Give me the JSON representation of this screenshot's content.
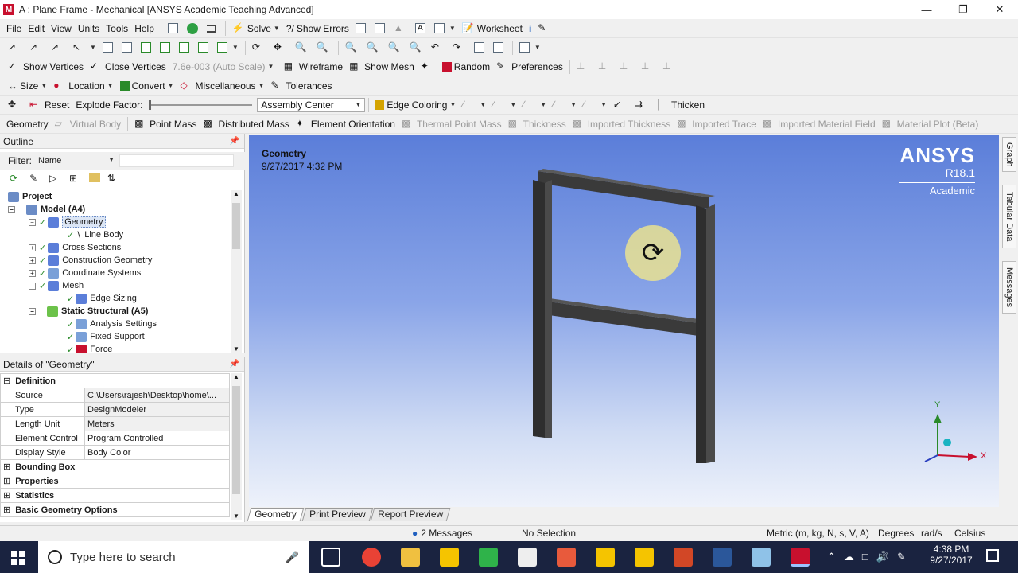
{
  "window": {
    "app_icon": "M",
    "title": "A : Plane Frame - Mechanical [ANSYS Academic Teaching Advanced]",
    "controls": [
      "minimize-icon",
      "restore-icon",
      "close-icon"
    ]
  },
  "menubar": {
    "items": [
      "File",
      "Edit",
      "View",
      "Units",
      "Tools",
      "Help"
    ],
    "solve": "Solve",
    "show_errors": "Show Errors",
    "worksheet": "Worksheet"
  },
  "toolbar3": {
    "show_vertices": "Show Vertices",
    "close_vertices": "Close Vertices",
    "scale": "7.6e-003 (Auto Scale)",
    "wireframe": "Wireframe",
    "show_mesh": "Show Mesh",
    "random": "Random",
    "preferences": "Preferences"
  },
  "toolbar4": {
    "size": "Size",
    "location": "Location",
    "convert": "Convert",
    "miscellaneous": "Miscellaneous",
    "tolerances": "Tolerances"
  },
  "toolbar5": {
    "reset": "Reset",
    "explode_factor": "Explode Factor:",
    "assembly_center": "Assembly Center",
    "edge_coloring": "Edge Coloring",
    "thicken": "Thicken"
  },
  "context_toolbar": {
    "geometry": "Geometry",
    "virtual_body": "Virtual Body",
    "point_mass": "Point Mass",
    "distributed_mass": "Distributed Mass",
    "element_orientation": "Element Orientation",
    "thermal_point_mass": "Thermal Point Mass",
    "thickness": "Thickness",
    "imported_thickness": "Imported Thickness",
    "imported_trace": "Imported Trace",
    "imported_material_field": "Imported Material Field",
    "material_plot": "Material Plot (Beta)"
  },
  "outline": {
    "header": "Outline",
    "filter_label": "Filter:",
    "filter_value": "Name",
    "tree": [
      {
        "label": "Project",
        "bold": true
      },
      {
        "label": "Model (A4)",
        "bold": true
      },
      {
        "label": "Geometry",
        "selected": true
      },
      {
        "label": "Line Body"
      },
      {
        "label": "Cross Sections"
      },
      {
        "label": "Construction Geometry"
      },
      {
        "label": "Coordinate Systems"
      },
      {
        "label": "Mesh"
      },
      {
        "label": "Edge Sizing"
      },
      {
        "label": "Static Structural (A5)",
        "bold": true
      },
      {
        "label": "Analysis Settings"
      },
      {
        "label": "Fixed Support"
      },
      {
        "label": "Force"
      }
    ]
  },
  "details": {
    "header": "Details of \"Geometry\"",
    "section_definition": "Definition",
    "rows": [
      {
        "key": "Source",
        "value": "C:\\Users\\rajesh\\Desktop\\home\\..."
      },
      {
        "key": "Type",
        "value": "DesignModeler"
      },
      {
        "key": "Length Unit",
        "value": "Meters"
      },
      {
        "key": "Element Control",
        "value": "Program Controlled"
      },
      {
        "key": "Display Style",
        "value": "Body Color"
      }
    ],
    "sections": [
      "Bounding Box",
      "Properties",
      "Statistics",
      "Basic Geometry Options"
    ]
  },
  "viewport": {
    "title": "Geometry",
    "timestamp": "9/27/2017 4:32 PM",
    "brand": "ANSYS",
    "version": "R18.1",
    "edition": "Academic",
    "axis_x": "X",
    "axis_y": "Y"
  },
  "side_tabs": [
    "Graph",
    "Tabular Data",
    "Messages"
  ],
  "bottom_tabs": [
    "Geometry",
    "Print Preview",
    "Report Preview"
  ],
  "statusbar": {
    "messages": "2 Messages",
    "selection": "No Selection",
    "units": "Metric (m, kg, N, s, V, A)",
    "degrees": "Degrees",
    "rads": "rad/s",
    "temp": "Celsius"
  },
  "taskbar": {
    "search_placeholder": "Type here to search",
    "time": "4:38 PM",
    "date": "9/27/2017"
  }
}
